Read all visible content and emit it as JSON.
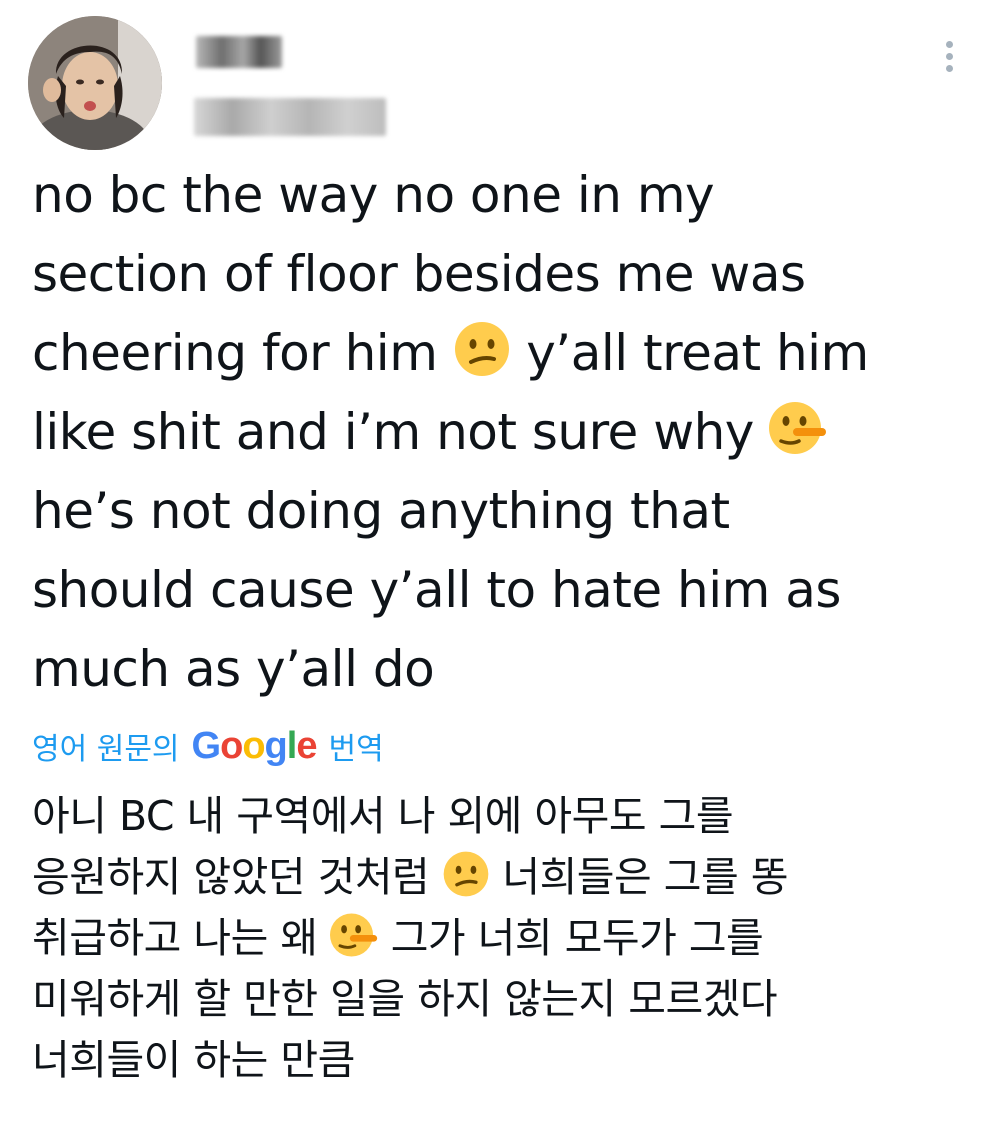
{
  "tweet": {
    "author": {
      "avatar_icon": "profile-photo",
      "display_name_obscured": true,
      "handle_obscured": true
    },
    "more_icon": "more-vertical-icon",
    "text_lines": [
      "no bc the way no one in my",
      "section of floor besides me was",
      "cheering for him",
      "y’all treat him",
      "like shit and i’m not sure why",
      "he’s not doing anything that",
      "should cause y’all to hate him as",
      "much as y’all do"
    ],
    "emojis": {
      "first": "confused-face",
      "second": "lying-face"
    }
  },
  "translation": {
    "prefix": "영어 원문의",
    "provider": "Google",
    "suffix": "번역",
    "link_color": "#1d9bf0",
    "lines": [
      "아니 BC 내 구역에서 나 외에 아무도 그를",
      "응원하지 않았던 것처럼",
      "너희들은 그를 똥",
      "취급하고 나는 왜",
      "그가 너희 모두가 그를",
      "미워하게 할 만한 일을 하지 않는지 모르겠다",
      "너희들이 하는 만큼"
    ]
  }
}
